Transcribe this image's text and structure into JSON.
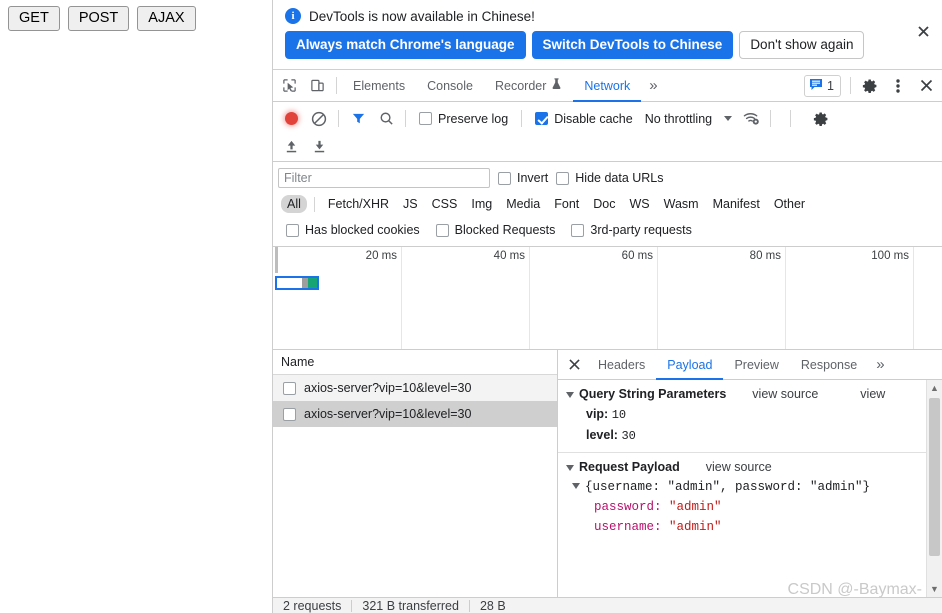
{
  "page": {
    "buttons": [
      {
        "label": "GET",
        "name": "get-button"
      },
      {
        "label": "POST",
        "name": "post-button"
      },
      {
        "label": "AJAX",
        "name": "ajax-button"
      }
    ]
  },
  "infobar": {
    "icon": "info-icon",
    "message": "DevTools is now available in Chinese!",
    "primary_button": "Always match Chrome's language",
    "secondary_button": "Switch DevTools to Chinese",
    "dismiss_button": "Don't show again",
    "close_icon": "close-icon",
    "accent_color": "#1a73e8"
  },
  "tabstrip": {
    "inspect_icon": "inspect-element-icon",
    "device_icon": "device-toolbar-icon",
    "tabs": [
      {
        "label": "Elements",
        "active": false
      },
      {
        "label": "Console",
        "active": false
      },
      {
        "label": "Recorder",
        "active": false,
        "badge_icon": "experiment-flask-icon"
      },
      {
        "label": "Network",
        "active": true
      }
    ],
    "more_tabs": "»",
    "issues_count": "1",
    "issues_icon": "issues-message-icon",
    "settings_icon": "gear-icon",
    "menu_icon": "kebab-menu-icon",
    "close_icon": "close-icon",
    "active_color": "#1a73e8"
  },
  "network_toolbar": {
    "record_icon": "record-stop-icon",
    "clear_icon": "clear-network-log-icon",
    "filter_icon": "filter-funnel-icon",
    "search_icon": "search-icon",
    "preserve_log": {
      "label": "Preserve log",
      "checked": false
    },
    "disable_cache": {
      "label": "Disable cache",
      "checked": true
    },
    "throttling": {
      "value": "No throttling",
      "caret": "chevron-down-icon"
    },
    "network_conditions_icon": "wifi-settings-icon",
    "settings_icon": "gear-icon",
    "import_icon": "import-har-icon",
    "export_icon": "export-har-icon"
  },
  "filter": {
    "placeholder": "Filter",
    "value": "",
    "invert": {
      "label": "Invert",
      "checked": false
    },
    "hide_data_urls": {
      "label": "Hide data URLs",
      "checked": false
    },
    "types": [
      {
        "label": "All",
        "selected": true
      },
      {
        "label": "Fetch/XHR",
        "selected": false
      },
      {
        "label": "JS",
        "selected": false
      },
      {
        "label": "CSS",
        "selected": false
      },
      {
        "label": "Img",
        "selected": false
      },
      {
        "label": "Media",
        "selected": false
      },
      {
        "label": "Font",
        "selected": false
      },
      {
        "label": "Doc",
        "selected": false
      },
      {
        "label": "WS",
        "selected": false
      },
      {
        "label": "Wasm",
        "selected": false
      },
      {
        "label": "Manifest",
        "selected": false
      },
      {
        "label": "Other",
        "selected": false
      }
    ],
    "has_blocked_cookies": {
      "label": "Has blocked cookies",
      "checked": false
    },
    "blocked_requests": {
      "label": "Blocked Requests",
      "checked": false
    },
    "third_party_requests": {
      "label": "3rd-party requests",
      "checked": false
    }
  },
  "overview": {
    "ticks": [
      "20 ms",
      "40 ms",
      "60 ms",
      "80 ms",
      "100 ms"
    ],
    "bar": {
      "border_color": "#1a73e8",
      "segments": [
        {
          "name": "waiting",
          "color": "#9e9e9e",
          "left_pct": 62,
          "width_pct": 16
        },
        {
          "name": "content-download",
          "color": "#17a673",
          "left_pct": 78,
          "width_pct": 22
        }
      ]
    }
  },
  "request_list": {
    "column_header": "Name",
    "rows": [
      {
        "name": "axios-server?vip=10&level=30",
        "checked": false,
        "selected": false
      },
      {
        "name": "axios-server?vip=10&level=30",
        "checked": false,
        "selected": true
      }
    ]
  },
  "details": {
    "close_icon": "close-icon",
    "tabs": [
      {
        "label": "Headers",
        "active": false
      },
      {
        "label": "Payload",
        "active": true
      },
      {
        "label": "Preview",
        "active": false
      },
      {
        "label": "Response",
        "active": false
      }
    ],
    "more_tabs": "»",
    "payload": {
      "query_string": {
        "title": "Query String Parameters",
        "view_source": "view source",
        "view_parsed_truncated": "view",
        "params": [
          {
            "key": "vip:",
            "value": "10"
          },
          {
            "key": "level:",
            "value": "30"
          }
        ]
      },
      "request_payload": {
        "title": "Request Payload",
        "view_source": "view source",
        "object_summary": "{username: \"admin\", password: \"admin\"}",
        "properties": [
          {
            "key": "password:",
            "value": "\"admin\""
          },
          {
            "key": "username:",
            "value": "\"admin\""
          }
        ]
      }
    },
    "scrollbar": {
      "up_icon": "scroll-up-arrow-icon",
      "down_icon": "scroll-down-arrow-icon"
    }
  },
  "statusbar": {
    "requests": "2 requests",
    "transferred": "321 B transferred",
    "resources": "28 B"
  },
  "watermark": "CSDN @-Baymax-"
}
